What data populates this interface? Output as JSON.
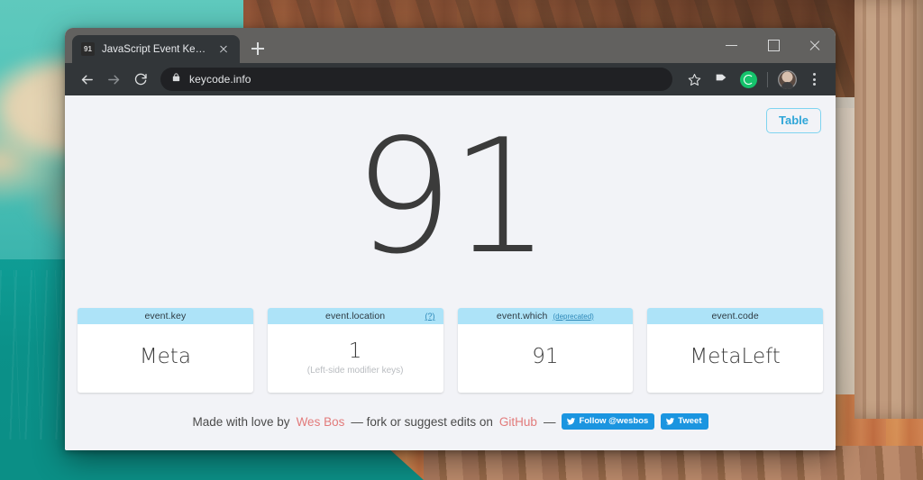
{
  "browser": {
    "tab": {
      "favicon_label": "91",
      "title": "JavaScript Event KeyCodes",
      "close_icon": "close-icon"
    },
    "new_tab_label": "+",
    "window_controls": {
      "minimize": "minimize-icon",
      "maximize": "maximize-icon",
      "close": "close-icon"
    },
    "toolbar": {
      "back": "back-arrow-icon",
      "forward": "forward-arrow-icon",
      "reload": "reload-icon",
      "lock": "lock-icon",
      "url": "keycode.info",
      "bookmark_star": "star-icon",
      "extension_flag": "flag-icon",
      "grammarly": "grammarly-icon",
      "profile": "avatar-icon",
      "menu": "kebab-menu-icon"
    }
  },
  "page": {
    "table_button": "Table",
    "keycode": "91",
    "cards": [
      {
        "title": "event.key",
        "note": "",
        "help": "",
        "value": "Meta",
        "sub": ""
      },
      {
        "title": "event.location",
        "note": "",
        "help": "(?)",
        "value": "1",
        "sub": "(Left-side modifier keys)"
      },
      {
        "title": "event.which",
        "note": "(deprecated)",
        "help": "",
        "value": "91",
        "sub": ""
      },
      {
        "title": "event.code",
        "note": "",
        "help": "",
        "value": "MetaLeft",
        "sub": ""
      }
    ],
    "footer": {
      "text_before": "Made with love by",
      "author": "Wes Bos",
      "text_middle": "— fork or suggest edits on",
      "repo": "GitHub",
      "text_after": "—",
      "follow_button": "Follow @wesbos",
      "tweet_button": "Tweet"
    }
  },
  "colors": {
    "card_header": "#ade3f8",
    "accent_blue": "#2fa6d8",
    "twitter_blue": "#1b95e0",
    "link_red": "#e27b7b",
    "page_bg": "#f2f3f7",
    "chrome_dark": "#323639"
  }
}
